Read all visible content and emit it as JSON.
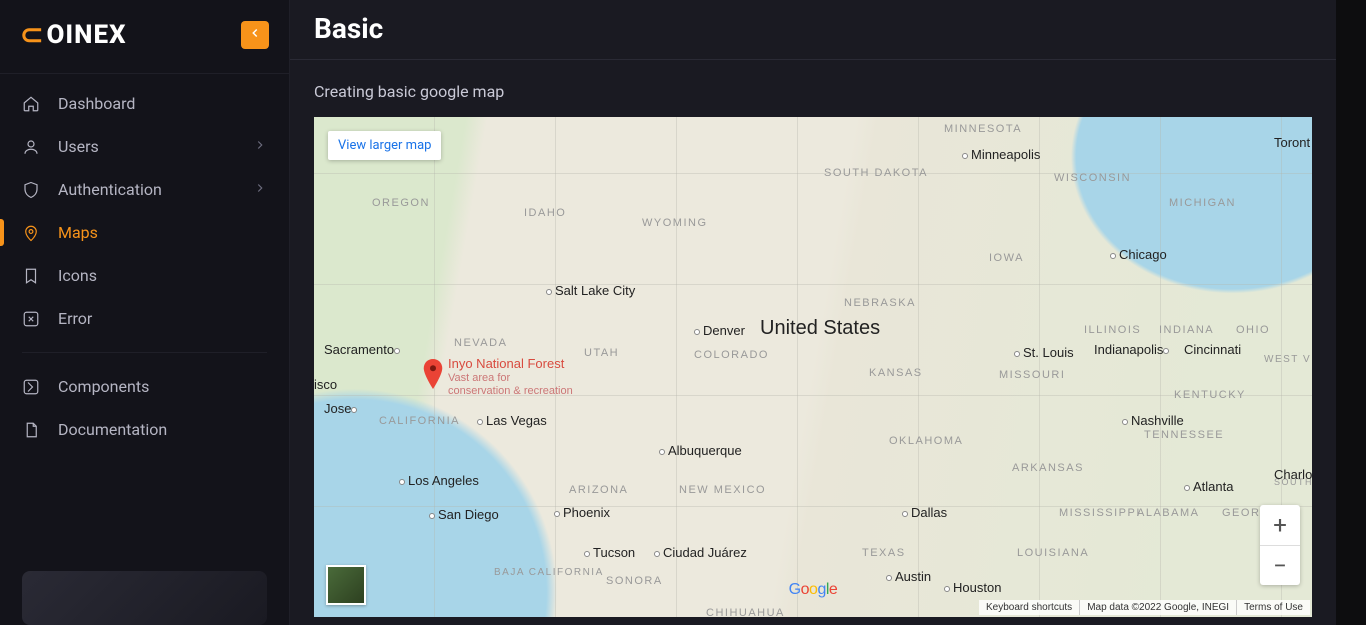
{
  "brand": "OINEX",
  "sidebar": {
    "items": [
      {
        "label": "Dashboard",
        "expandable": false
      },
      {
        "label": "Users",
        "expandable": true
      },
      {
        "label": "Authentication",
        "expandable": true
      },
      {
        "label": "Maps",
        "expandable": false
      },
      {
        "label": "Icons",
        "expandable": false
      },
      {
        "label": "Error",
        "expandable": false
      }
    ],
    "items2": [
      {
        "label": "Components"
      },
      {
        "label": "Documentation"
      }
    ]
  },
  "page": {
    "title": "Basic",
    "subtitle": "Creating basic google map"
  },
  "map": {
    "view_larger": "View larger map",
    "country": "United States",
    "marker": {
      "title": "Inyo National Forest",
      "subtitle1": "Vast area for",
      "subtitle2": "conservation & recreation"
    },
    "states": [
      "OREGON",
      "IDAHO",
      "WYOMING",
      "SOUTH DAKOTA",
      "MINNESOTA",
      "WISCONSIN",
      "MICHIGAN",
      "NEVADA",
      "UTAH",
      "COLORADO",
      "NEBRASKA",
      "IOWA",
      "ILLINOIS",
      "INDIANA",
      "OHIO",
      "KANSAS",
      "MISSOURI",
      "WEST VIRGINI",
      "CALIFORNIA",
      "ARIZONA",
      "NEW MEXICO",
      "OKLAHOMA",
      "ARKANSAS",
      "KENTUCKY",
      "TENNESSEE",
      "TEXAS",
      "LOUISIANA",
      "MISSISSIPPI",
      "ALABAMA",
      "GEORGIA",
      "SOUTH CAROLINA",
      "BAJA CALIFORNIA",
      "SONORA",
      "CHIHUAHUA"
    ],
    "cities": [
      "Minneapolis",
      "Toront",
      "Chicago",
      "Salt Lake City",
      "Denver",
      "Sacramento",
      "Indianapolis",
      "Cincinnati",
      "St. Louis",
      "isco",
      "Jose",
      "Las Vegas",
      "Nashville",
      "Albuquerque",
      "Los Angeles",
      "Charlott",
      "Atlanta",
      "San Diego",
      "Phoenix",
      "Dallas",
      "Tucson",
      "Austin",
      "Houston",
      "Ciudad Juárez"
    ],
    "footer": {
      "shortcuts": "Keyboard shortcuts",
      "data": "Map data ©2022 Google, INEGI",
      "terms": "Terms of Use"
    },
    "logo": "Google"
  }
}
